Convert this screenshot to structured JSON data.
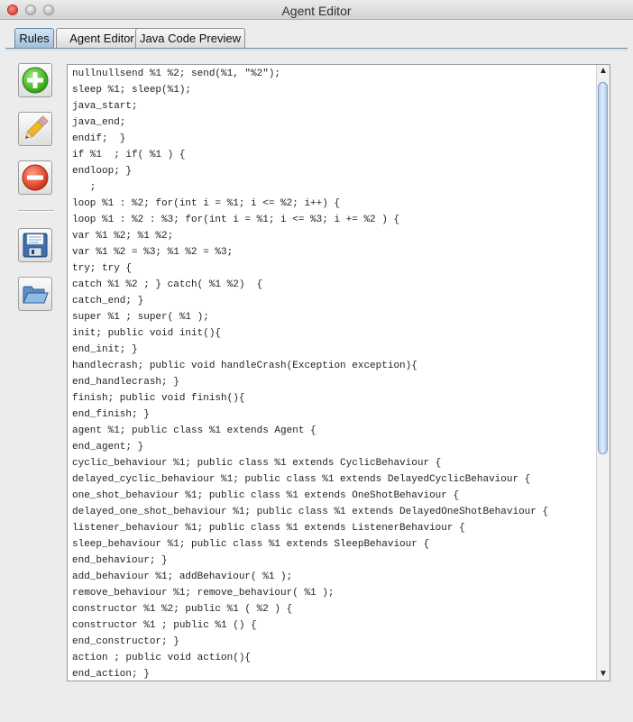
{
  "window": {
    "title": "Agent Editor"
  },
  "tabs": [
    {
      "label": "Rules",
      "active": true
    },
    {
      "label": "Agent Editor",
      "active": false
    },
    {
      "label": "Java Code Preview",
      "active": false
    }
  ],
  "toolbar": [
    {
      "icon": "add-icon",
      "action": "add"
    },
    {
      "icon": "pencil-icon",
      "action": "edit"
    },
    {
      "icon": "remove-icon",
      "action": "remove"
    },
    {
      "icon": "save-icon",
      "action": "save"
    },
    {
      "icon": "folder-open-icon",
      "action": "open"
    }
  ],
  "editor": {
    "scroll_position": 0.02,
    "visible_fraction": 0.63,
    "lines": [
      "nullnullsend %1 %2; send(%1, \"%2\");",
      "sleep %1; sleep(%1);",
      "java_start;",
      "java_end;",
      "endif;  }",
      "if %1  ; if( %1 ) {",
      "endloop; }",
      "   ;",
      "loop %1 : %2; for(int i = %1; i <= %2; i++) {",
      "loop %1 : %2 : %3; for(int i = %1; i <= %3; i += %2 ) {",
      "var %1 %2; %1 %2;",
      "var %1 %2 = %3; %1 %2 = %3;",
      "try; try {",
      "catch %1 %2 ; } catch( %1 %2)  {",
      "catch_end; }",
      "super %1 ; super( %1 );",
      "init; public void init(){",
      "end_init; }",
      "handlecrash; public void handleCrash(Exception exception){",
      "end_handlecrash; }",
      "finish; public void finish(){",
      "end_finish; }",
      "agent %1; public class %1 extends Agent {",
      "end_agent; }",
      "cyclic_behaviour %1; public class %1 extends CyclicBehaviour {",
      "delayed_cyclic_behaviour %1; public class %1 extends DelayedCyclicBehaviour {",
      "one_shot_behaviour %1; public class %1 extends OneShotBehaviour {",
      "delayed_one_shot_behaviour %1; public class %1 extends DelayedOneShotBehaviour {",
      "listener_behaviour %1; public class %1 extends ListenerBehaviour {",
      "sleep_behaviour %1; public class %1 extends SleepBehaviour {",
      "end_behaviour; }",
      "add_behaviour %1; addBehaviour( %1 );",
      "remove_behaviour %1; remove_behaviour( %1 );",
      "constructor %1 %2; public %1 ( %2 ) {",
      "constructor %1 ; public %1 () {",
      "end_constructor; }",
      "action ; public void action(){",
      "end_action; }"
    ]
  }
}
